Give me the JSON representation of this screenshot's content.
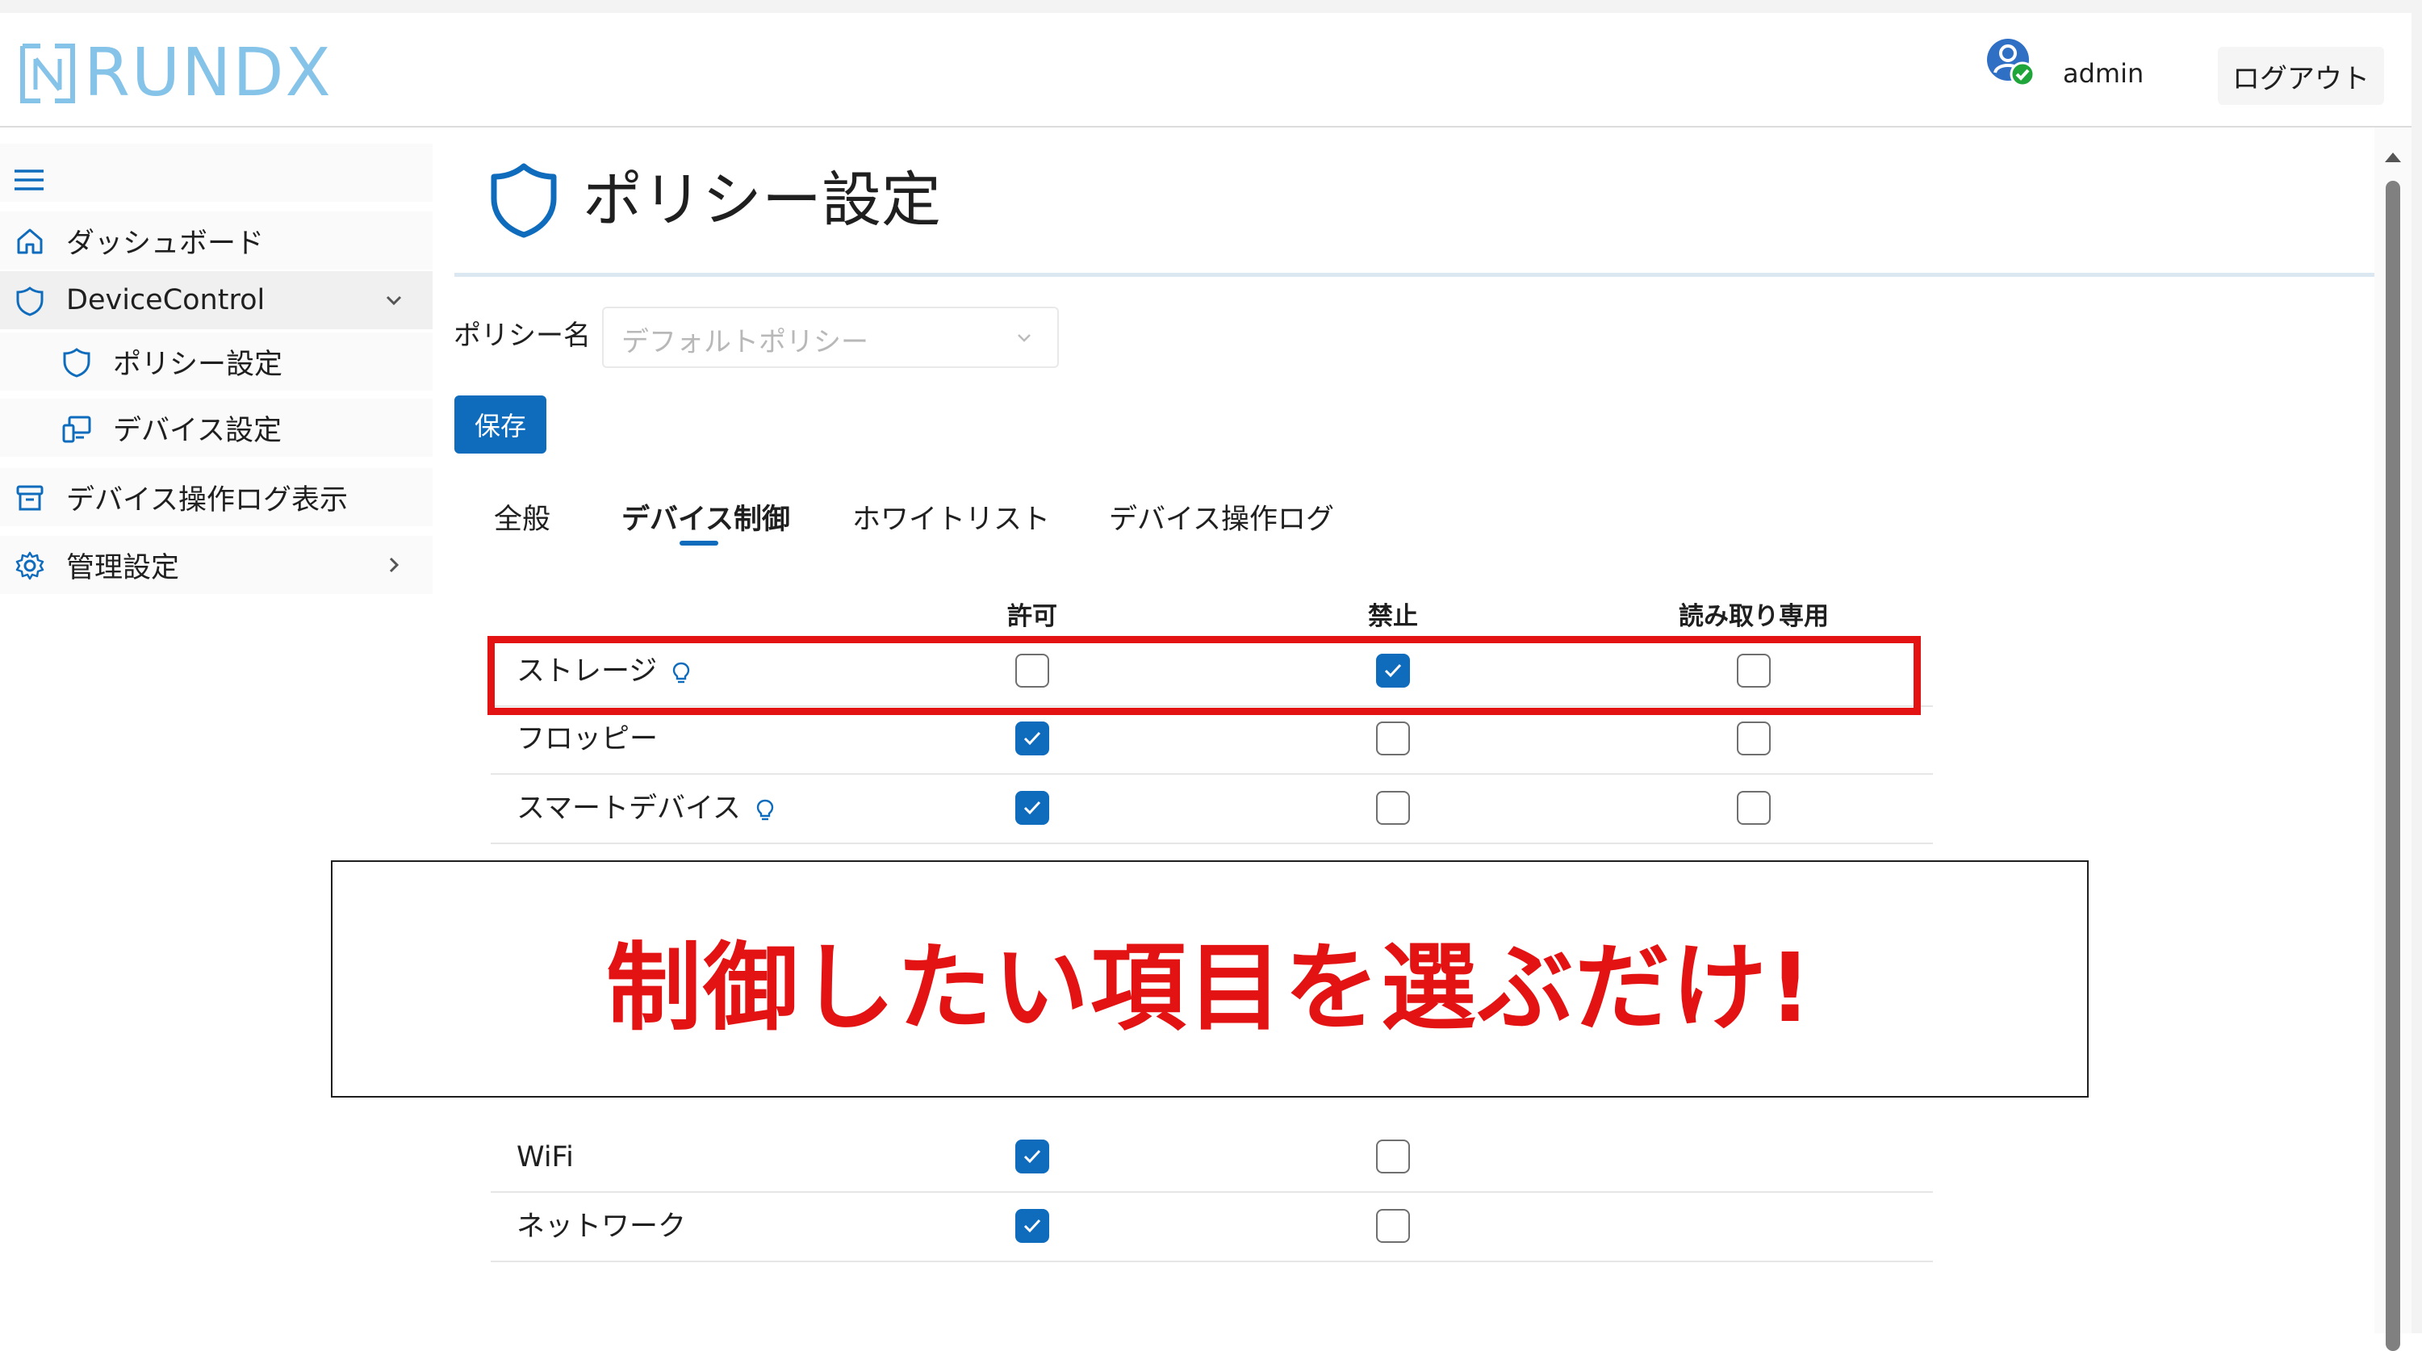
{
  "colors": {
    "accent": "#0f6cbd",
    "logo": "#86c3e8",
    "highlight": "#e41313"
  },
  "header": {
    "logo_text": "RUNDX",
    "user_name": "admin",
    "logout_label": "ログアウト"
  },
  "sidebar": {
    "items": [
      {
        "label": "ダッシュボード",
        "icon": "home-icon"
      },
      {
        "label": "DeviceControl",
        "icon": "shield-icon",
        "expanded": true
      },
      {
        "label": "ポリシー設定",
        "icon": "shield-icon",
        "selected": true
      },
      {
        "label": "デバイス設定",
        "icon": "devices-icon"
      },
      {
        "label": "デバイス操作ログ表示",
        "icon": "archive-icon"
      },
      {
        "label": "管理設定",
        "icon": "gear-icon"
      }
    ]
  },
  "page": {
    "title": "ポリシー設定",
    "policy_name_label": "ポリシー名",
    "policy_placeholder": "デフォルトポリシー",
    "save_label": "保存"
  },
  "tabs": [
    {
      "label": "全般",
      "active": false
    },
    {
      "label": "デバイス制御",
      "active": true
    },
    {
      "label": "ホワイトリスト",
      "active": false
    },
    {
      "label": "デバイス操作ログ",
      "active": false
    }
  ],
  "table": {
    "columns": [
      "許可",
      "禁止",
      "読み取り専用"
    ],
    "rows": [
      {
        "label": "ストレージ",
        "hint": true,
        "checks": [
          false,
          true,
          false
        ]
      },
      {
        "label": "フロッピー",
        "hint": false,
        "checks": [
          true,
          false,
          false
        ]
      },
      {
        "label": "スマートデバイス",
        "hint": true,
        "checks": [
          true,
          false,
          false
        ]
      },
      {
        "label": "WiFi",
        "hint": false,
        "checks": [
          true,
          false,
          null
        ]
      },
      {
        "label": "ネットワーク",
        "hint": false,
        "checks": [
          true,
          false,
          null
        ]
      }
    ]
  },
  "callout": {
    "text": "制御したい項目を選ぶだけ!"
  }
}
